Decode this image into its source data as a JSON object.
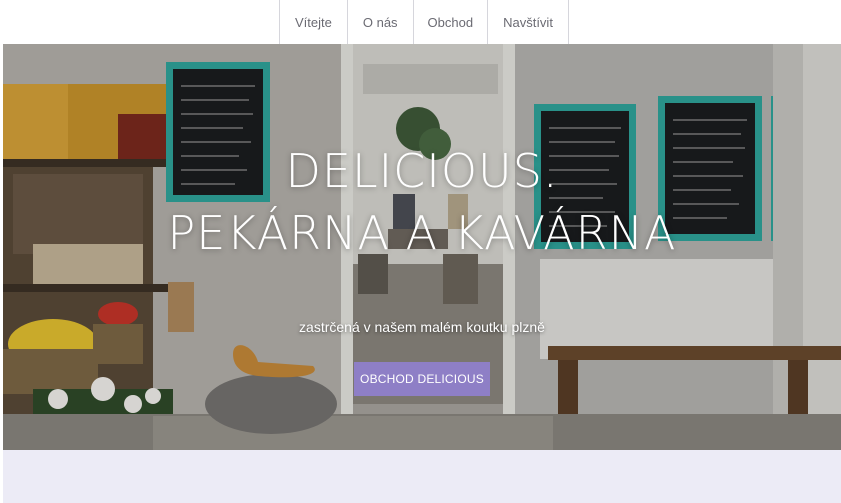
{
  "nav": {
    "items": [
      "Vítejte",
      "O nás",
      "Obchod",
      "Navštívit"
    ]
  },
  "hero": {
    "title_line1": "DELICIOUS.",
    "title_line2": "PEKÁRNA A KAVÁRNA",
    "subtitle": "zastrčená v našem malém koutku plzně",
    "button_label": "OBCHOD DELICIOUS"
  },
  "colors": {
    "accent": "#8e7fc6",
    "bottom_band": "#ecebf6",
    "nav_text": "#6b6b73"
  }
}
